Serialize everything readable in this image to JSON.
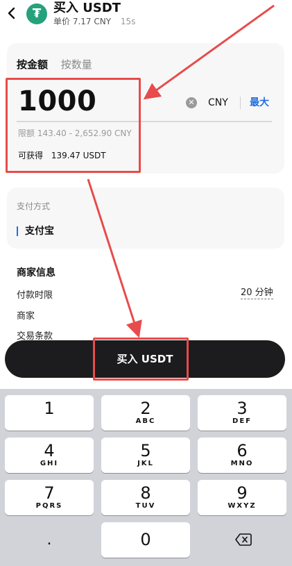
{
  "header": {
    "title": "买入 USDT",
    "unit_price": "单价 7.17 CNY",
    "timer": "15s"
  },
  "amount_card": {
    "tabs": [
      {
        "label": "按金额",
        "active": true
      },
      {
        "label": "按数量",
        "active": false
      }
    ],
    "amount_value": "1000",
    "currency": "CNY",
    "max_label": "最大",
    "limit_text": "限额 143.40 - 2,652.90 CNY",
    "obtain_label": "可获得",
    "obtain_value": "139.47 USDT"
  },
  "payment": {
    "label": "支付方式",
    "method": "支付宝"
  },
  "merchant": {
    "title": "商家信息",
    "payment_time_label": "付款时限",
    "payment_time_value": "20 分钟",
    "merchant_label": "商家",
    "terms_label": "交易条款"
  },
  "buy_button": {
    "label": "买入 USDT"
  },
  "keyboard": {
    "keys": [
      {
        "num": "1",
        "letters": ""
      },
      {
        "num": "2",
        "letters": "ABC"
      },
      {
        "num": "3",
        "letters": "DEF"
      },
      {
        "num": "4",
        "letters": "GHI"
      },
      {
        "num": "5",
        "letters": "JKL"
      },
      {
        "num": "6",
        "letters": "MNO"
      },
      {
        "num": "7",
        "letters": "PQRS"
      },
      {
        "num": "8",
        "letters": "TUV"
      },
      {
        "num": "9",
        "letters": "WXYZ"
      }
    ],
    "dot": ".",
    "zero": "0"
  },
  "colors": {
    "accent_blue": "#1f6fde",
    "tether_green": "#26a17b",
    "annotation_red": "#e84b4b",
    "button_dark": "#1c1c1e"
  }
}
